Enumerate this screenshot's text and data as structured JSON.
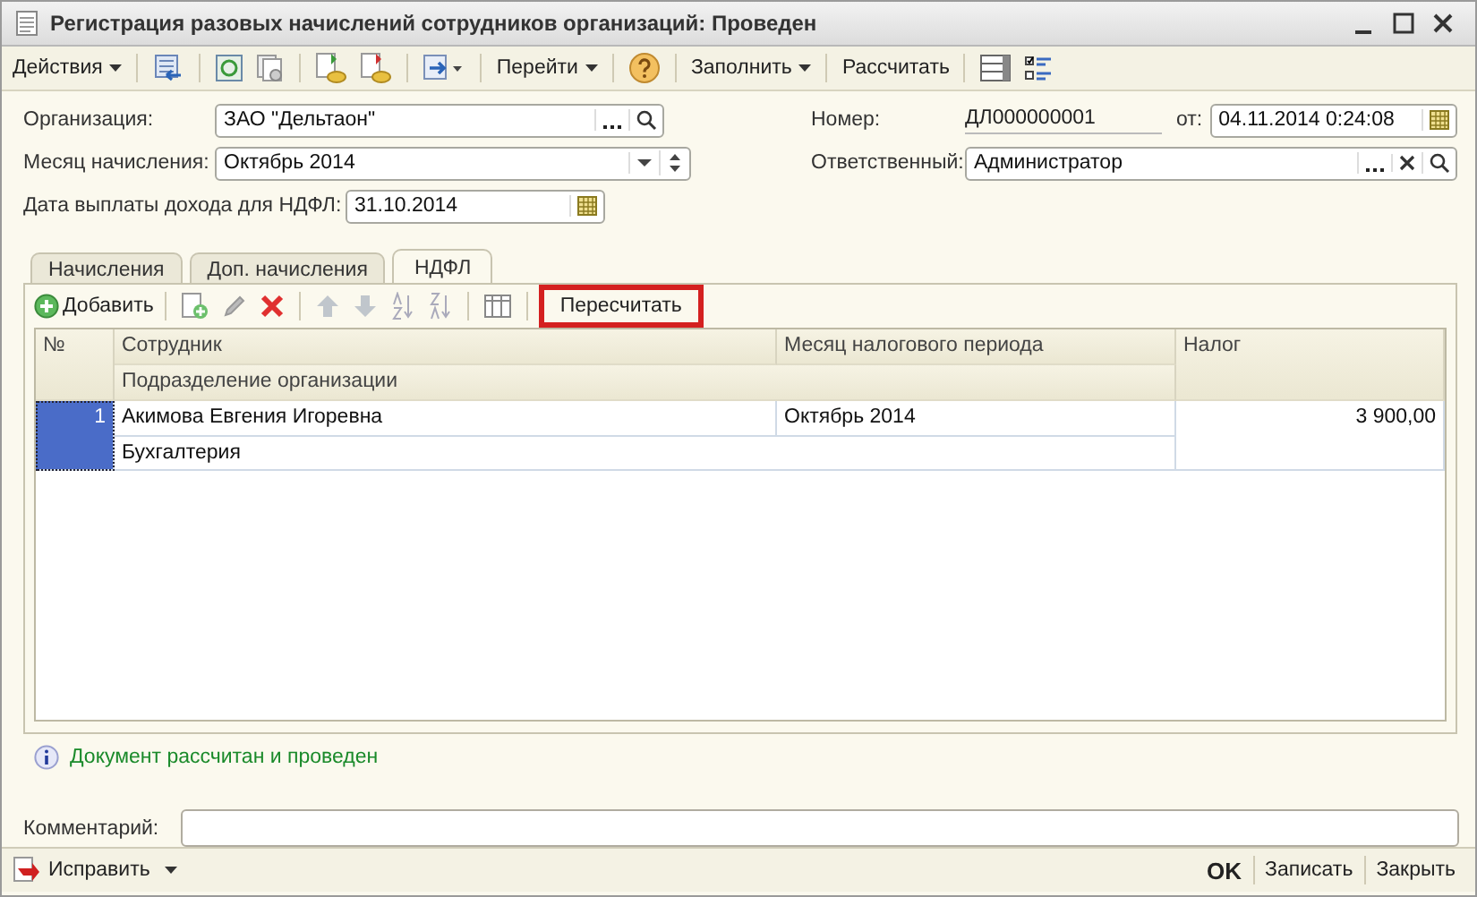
{
  "window": {
    "title": "Регистрация разовых начислений сотрудников организаций: Проведен"
  },
  "toolbar": [
    {
      "kind": "menu",
      "label": "Действия"
    },
    {
      "kind": "menu",
      "label": "Перейти"
    },
    {
      "kind": "menu",
      "label": "Заполнить"
    },
    {
      "kind": "button",
      "label": "Рассчитать"
    }
  ],
  "form": {
    "organization": {
      "label": "Организация:",
      "value": "ЗАО \"Дельтаон\""
    },
    "month": {
      "label": "Месяц начисления:",
      "value": "Октябрь 2014"
    },
    "pay_date": {
      "label": "Дата выплаты дохода для НДФЛ:",
      "value": "31.10.2014"
    },
    "number": {
      "label": "Номер:",
      "value": "ДЛ000000001"
    },
    "date": {
      "label": "от:",
      "value": "04.11.2014  0:24:08"
    },
    "responsible": {
      "label": "Ответственный:",
      "value": "Администратор"
    }
  },
  "tabs": [
    {
      "label": "Начисления",
      "selected": false
    },
    {
      "label": "Доп. начисления",
      "selected": false
    },
    {
      "label": "НДФЛ",
      "selected": true
    }
  ],
  "tab_toolbar": {
    "add_button": "Добавить",
    "recalc_button": {
      "label": "Пересчитать",
      "highlighted": true
    }
  },
  "table": {
    "columns": [
      "№",
      "Сотрудник",
      "Подразделение организации",
      "Месяц налогового периода",
      "Налог"
    ],
    "rows": [
      {
        "number": "1",
        "employee": "Акимова Евгения Игоревна",
        "department": "Бухгалтерия",
        "month": "Октябрь 2014",
        "tax": "3 900,00",
        "selected": true
      }
    ]
  },
  "message": "Документ рассчитан и проведен",
  "comment": {
    "label": "Комментарий:"
  },
  "footer": {
    "fix_button": "Исправить",
    "buttons": [
      "OK",
      "Записать",
      "Закрыть"
    ]
  }
}
